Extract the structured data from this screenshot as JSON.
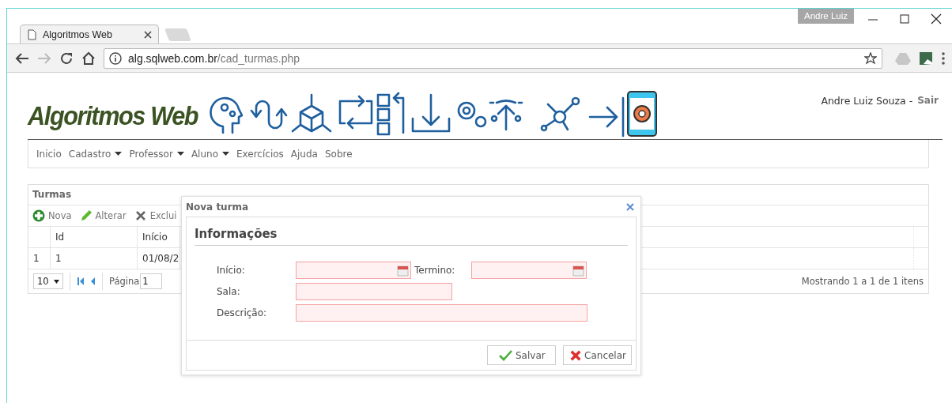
{
  "browser": {
    "tab": {
      "title": "Algoritmos Web",
      "selected": true
    },
    "profile": "Andre Luiz",
    "address": {
      "host": "alg.sqlweb.com.br",
      "path": "/cad_turmas.php"
    }
  },
  "header": {
    "logo": "Algoritmos Web",
    "user": "Andre Luiz Souza -",
    "logout": "Sair"
  },
  "menu": [
    {
      "label": "Inicio",
      "dropdown": false
    },
    {
      "label": "Cadastro",
      "dropdown": true
    },
    {
      "label": "Professor",
      "dropdown": true
    },
    {
      "label": "Aluno",
      "dropdown": true
    },
    {
      "label": "Exercícios",
      "dropdown": false
    },
    {
      "label": "Ajuda",
      "dropdown": false
    },
    {
      "label": "Sobre",
      "dropdown": false
    }
  ],
  "grid": {
    "title": "Turmas",
    "toolbar": [
      {
        "label": "Nova",
        "kind": "add"
      },
      {
        "label": "Alterar",
        "kind": "edit"
      },
      {
        "label": "Exclui",
        "kind": "delete"
      }
    ],
    "columns": [
      "Id",
      "Início"
    ],
    "rows": [
      {
        "number": "1",
        "cells": [
          "1",
          "01/08/2"
        ]
      }
    ],
    "pager": {
      "page_size": "10",
      "page_label": "Página",
      "page": "1",
      "summary": "Mostrando 1 a 1 de 1 itens"
    }
  },
  "dialog": {
    "title": "Nova turma",
    "section": "Informações",
    "fields": [
      {
        "label": "Início:",
        "kind": "date",
        "invalid": true
      },
      {
        "label": "Termino:",
        "kind": "date",
        "invalid": true
      },
      {
        "label": "Sala:",
        "kind": "text",
        "invalid": true
      },
      {
        "label": "Descrição:",
        "kind": "text",
        "invalid": true
      }
    ],
    "buttons": [
      {
        "label": "Salvar",
        "kind": "save"
      },
      {
        "label": "Cancelar",
        "kind": "cancel"
      }
    ]
  }
}
